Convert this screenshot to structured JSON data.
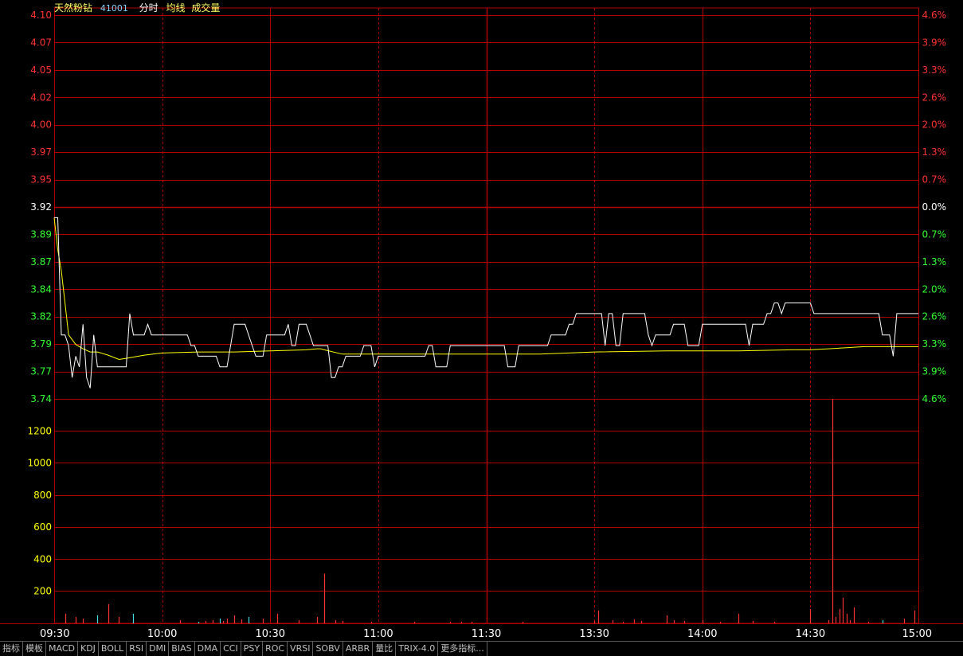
{
  "header": {
    "stock_name": "天然粉钻",
    "stock_code": "41001",
    "chart_label": "分时",
    "avg_label": "均线",
    "volume_label": "成交量"
  },
  "colors": {
    "background": "#000000",
    "grid": "#b40000",
    "price_line": "#ffffff",
    "avg_line": "#ffff00",
    "up": "#ff3333",
    "down": "#33ff33",
    "neutral": "#ffffff",
    "volume_up": "#ff3333",
    "volume_down": "#40e0e0",
    "volume_axis": "#ffff00",
    "time_labels": "#ffffff"
  },
  "chart_data": {
    "type": "line",
    "price_axis": {
      "left_labels": [
        "4.10",
        "4.07",
        "4.05",
        "4.02",
        "4.00",
        "3.97",
        "3.95",
        "3.92",
        "3.89",
        "3.87",
        "3.84",
        "3.82",
        "3.79",
        "3.77",
        "3.74"
      ],
      "right_labels": [
        "4.6%",
        "3.9%",
        "3.3%",
        "2.6%",
        "2.0%",
        "1.3%",
        "0.7%",
        "0.0%",
        "0.7%",
        "1.3%",
        "2.0%",
        "2.6%",
        "3.3%",
        "3.9%",
        "4.6%"
      ],
      "ylim": [
        3.74,
        4.1
      ],
      "prev_close": 3.92
    },
    "volume_axis": {
      "labels": [
        "1200",
        "1000",
        "800",
        "600",
        "400",
        "200"
      ],
      "ylim": [
        0,
        1400
      ]
    },
    "time_labels": [
      "09:30",
      "10:00",
      "10:30",
      "11:00",
      "11:30",
      "13:30",
      "14:00",
      "14:30",
      "15:00"
    ],
    "session_minutes": 240,
    "price_series": {
      "name": "分时",
      "x": [
        0,
        1,
        2,
        3,
        4,
        5,
        6,
        7,
        8,
        9,
        10,
        11,
        12,
        13,
        14,
        15,
        16,
        17,
        18,
        19,
        20,
        21,
        22,
        23,
        24,
        25,
        26,
        27,
        28,
        29,
        30,
        31,
        32,
        33,
        34,
        35,
        36,
        37,
        38,
        39,
        40,
        41,
        42,
        43,
        44,
        45,
        46,
        47,
        48,
        49,
        50,
        51,
        52,
        53,
        54,
        55,
        56,
        57,
        58,
        59,
        60,
        61,
        62,
        63,
        64,
        65,
        66,
        67,
        68,
        69,
        70,
        71,
        72,
        73,
        74,
        75,
        76,
        77,
        78,
        79,
        80,
        81,
        82,
        83,
        84,
        85,
        86,
        87,
        88,
        89,
        90,
        91,
        92,
        93,
        94,
        95,
        96,
        97,
        98,
        99,
        100,
        101,
        102,
        103,
        104,
        105,
        106,
        107,
        108,
        109,
        110,
        111,
        112,
        113,
        114,
        115,
        116,
        117,
        118,
        119,
        120,
        121,
        122,
        123,
        124,
        125,
        126,
        127,
        128,
        129,
        130,
        131,
        132,
        133,
        134,
        135,
        136,
        137,
        138,
        139,
        140,
        141,
        142,
        143,
        144,
        145,
        146,
        147,
        148,
        149,
        150,
        151,
        152,
        153,
        154,
        155,
        156,
        157,
        158,
        159,
        160,
        161,
        162,
        163,
        164,
        165,
        166,
        167,
        168,
        169,
        170,
        171,
        172,
        173,
        174,
        175,
        176,
        177,
        178,
        179,
        180,
        181,
        182,
        183,
        184,
        185,
        186,
        187,
        188,
        189,
        190,
        191,
        192,
        193,
        194,
        195,
        196,
        197,
        198,
        199,
        200,
        201,
        202,
        203,
        204,
        205,
        206,
        207,
        208,
        209,
        210,
        211,
        212,
        213,
        214,
        215,
        216,
        217,
        218,
        219,
        220,
        221,
        222,
        223,
        224,
        225,
        226,
        227,
        228,
        229,
        230,
        231,
        232,
        233,
        234,
        235,
        236,
        237,
        238,
        239,
        240
      ],
      "values": [
        3.91,
        3.91,
        3.8,
        3.8,
        3.79,
        3.76,
        3.78,
        3.77,
        3.81,
        3.76,
        3.75,
        3.8,
        3.77,
        3.77,
        3.77,
        3.77,
        3.77,
        3.77,
        3.77,
        3.77,
        3.77,
        3.82,
        3.8,
        3.8,
        3.8,
        3.8,
        3.81,
        3.8,
        3.8,
        3.8,
        3.8,
        3.8,
        3.8,
        3.8,
        3.8,
        3.8,
        3.8,
        3.8,
        3.79,
        3.79,
        3.78,
        3.78,
        3.78,
        3.78,
        3.78,
        3.78,
        3.77,
        3.77,
        3.77,
        3.79,
        3.81,
        3.81,
        3.81,
        3.81,
        3.8,
        3.79,
        3.78,
        3.78,
        3.78,
        3.8,
        3.8,
        3.8,
        3.8,
        3.8,
        3.8,
        3.81,
        3.79,
        3.79,
        3.81,
        3.81,
        3.81,
        3.8,
        3.79,
        3.79,
        3.79,
        3.79,
        3.79,
        3.76,
        3.76,
        3.77,
        3.77,
        3.78,
        3.78,
        3.78,
        3.78,
        3.78,
        3.79,
        3.79,
        3.79,
        3.77,
        3.78,
        3.78,
        3.78,
        3.78,
        3.78,
        3.78,
        3.78,
        3.78,
        3.78,
        3.78,
        3.78,
        3.78,
        3.78,
        3.78,
        3.79,
        3.79,
        3.77,
        3.77,
        3.77,
        3.77,
        3.79,
        3.79,
        3.79,
        3.79,
        3.79,
        3.79,
        3.79,
        3.79,
        3.79,
        3.79,
        3.79,
        3.79,
        3.79,
        3.79,
        3.79,
        3.79,
        3.77,
        3.77,
        3.77,
        3.79,
        3.79,
        3.79,
        3.79,
        3.79,
        3.79,
        3.79,
        3.79,
        3.79,
        3.8,
        3.8,
        3.8,
        3.8,
        3.8,
        3.81,
        3.81,
        3.82,
        3.82,
        3.82,
        3.82,
        3.82,
        3.82,
        3.82,
        3.82,
        3.79,
        3.82,
        3.82,
        3.79,
        3.79,
        3.82,
        3.82,
        3.82,
        3.82,
        3.82,
        3.82,
        3.82,
        3.8,
        3.79,
        3.8,
        3.8,
        3.8,
        3.8,
        3.8,
        3.81,
        3.81,
        3.81,
        3.81,
        3.79,
        3.79,
        3.79,
        3.79,
        3.81,
        3.81,
        3.81,
        3.81,
        3.81,
        3.81,
        3.81,
        3.81,
        3.81,
        3.81,
        3.81,
        3.81,
        3.81,
        3.79,
        3.81,
        3.81,
        3.81,
        3.81,
        3.82,
        3.82,
        3.83,
        3.83,
        3.82,
        3.83,
        3.83,
        3.83,
        3.83,
        3.83,
        3.83,
        3.83,
        3.83,
        3.82,
        3.82,
        3.82,
        3.82,
        3.82,
        3.82,
        3.82,
        3.82,
        3.82,
        3.82,
        3.82,
        3.82,
        3.82,
        3.82,
        3.82,
        3.82,
        3.82,
        3.82,
        3.82,
        3.8,
        3.8,
        3.8,
        3.78,
        3.82,
        3.82,
        3.82,
        3.82,
        3.82,
        3.82,
        3.82,
        3.82,
        3.82,
        3.76,
        3.76,
        3.76,
        3.76,
        3.76,
        3.81,
        3.81,
        3.82,
        3.81,
        3.81
      ]
    },
    "avg_series": {
      "name": "均线",
      "x": [
        0,
        1,
        2,
        3,
        4,
        6,
        8,
        10,
        12,
        15,
        18,
        20,
        25,
        30,
        40,
        50,
        60,
        70,
        73,
        74,
        75,
        80,
        100,
        130,
        135,
        150,
        170,
        180,
        190,
        205,
        210,
        215,
        220,
        225,
        230,
        235,
        240
      ],
      "values": [
        3.91,
        3.88,
        3.86,
        3.83,
        3.8,
        3.791,
        3.787,
        3.784,
        3.784,
        3.781,
        3.777,
        3.778,
        3.781,
        3.783,
        3.784,
        3.784,
        3.785,
        3.786,
        3.787,
        3.787,
        3.786,
        3.782,
        3.782,
        3.782,
        3.782,
        3.784,
        3.785,
        3.785,
        3.785,
        3.786,
        3.786,
        3.787,
        3.788,
        3.789,
        3.789,
        3.789,
        3.789
      ]
    },
    "volume_series": {
      "name": "成交量",
      "x": [
        3,
        6,
        8,
        12,
        15,
        18,
        22,
        35,
        40,
        42,
        44,
        46,
        47,
        48,
        50,
        52,
        54,
        58,
        62,
        68,
        73,
        75,
        78,
        80,
        88,
        100,
        110,
        113,
        116,
        130,
        150,
        151,
        155,
        158,
        161,
        163,
        170,
        172,
        175,
        180,
        185,
        190,
        194,
        200,
        210,
        215,
        216,
        217,
        218,
        219,
        220,
        221,
        222,
        226,
        230,
        236,
        239
      ],
      "values": [
        60,
        40,
        30,
        50,
        120,
        40,
        60,
        20,
        10,
        15,
        20,
        30,
        15,
        30,
        50,
        25,
        40,
        30,
        60,
        20,
        40,
        310,
        20,
        15,
        10,
        10,
        10,
        10,
        10,
        10,
        15,
        80,
        20,
        10,
        25,
        15,
        50,
        20,
        15,
        20,
        10,
        60,
        15,
        10,
        90,
        20,
        1400,
        40,
        90,
        160,
        60,
        20,
        100,
        10,
        20,
        30,
        80
      ]
    }
  },
  "tabs": [
    "指标",
    "模板",
    "MACD",
    "KDJ",
    "BOLL",
    "RSI",
    "DMI",
    "BIAS",
    "DMA",
    "CCI",
    "PSY",
    "ROC",
    "VRSI",
    "SOBV",
    "ARBR",
    "量比",
    "TRIX-4.0",
    "更多指标..."
  ]
}
